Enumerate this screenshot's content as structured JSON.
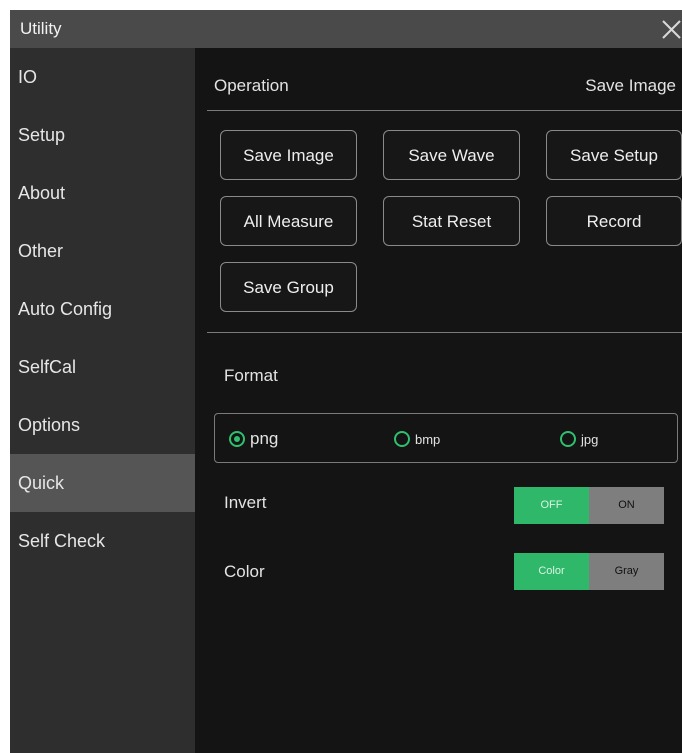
{
  "window": {
    "title": "Utility"
  },
  "sidebar": {
    "items": [
      {
        "label": "IO",
        "active": false
      },
      {
        "label": "Setup",
        "active": false
      },
      {
        "label": "About",
        "active": false
      },
      {
        "label": "Other",
        "active": false
      },
      {
        "label": "Auto Config",
        "active": false
      },
      {
        "label": "SelfCal",
        "active": false
      },
      {
        "label": "Options",
        "active": false
      },
      {
        "label": "Quick",
        "active": true
      },
      {
        "label": "Self Check",
        "active": false
      }
    ]
  },
  "operation": {
    "label": "Operation",
    "value": "Save Image",
    "buttons": [
      "Save Image",
      "Save Wave",
      "Save Setup",
      "All Measure",
      "Stat Reset",
      "Record",
      "Save Group"
    ]
  },
  "format": {
    "label": "Format",
    "options": [
      "png",
      "bmp",
      "jpg"
    ],
    "selected": "png"
  },
  "invert": {
    "label": "Invert",
    "off": "OFF",
    "on": "ON",
    "value": "OFF"
  },
  "color": {
    "label": "Color",
    "color": "Color",
    "gray": "Gray",
    "value": "Color"
  },
  "colors": {
    "accent": "#2fb86a",
    "sidebar_active": "#555555",
    "titlebar": "#4a4a4a"
  }
}
